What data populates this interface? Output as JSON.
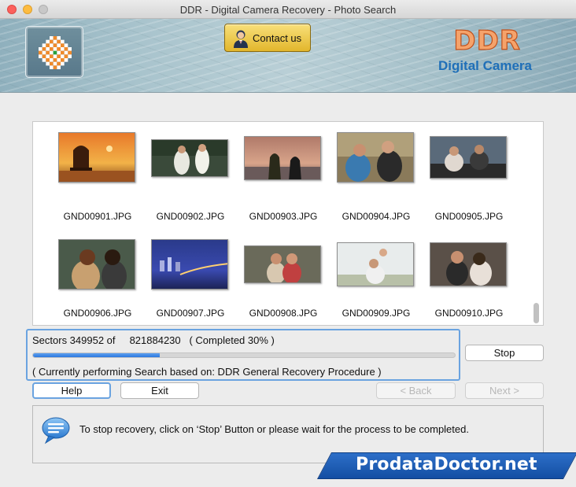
{
  "window": {
    "title": "DDR - Digital Camera Recovery - Photo Search"
  },
  "header": {
    "contact_label": "Contact us",
    "brand_name": "DDR",
    "brand_sub": "Digital Camera"
  },
  "gallery": {
    "files": [
      "GND00901.JPG",
      "GND00902.JPG",
      "GND00903.JPG",
      "GND00904.JPG",
      "GND00905.JPG",
      "GND00906.JPG",
      "GND00907.JPG",
      "GND00908.JPG",
      "GND00909.JPG",
      "GND00910.JPG"
    ]
  },
  "progress": {
    "sectors_text": "Sectors 349952 of     821884230   ( Completed 30% )",
    "fraction": 0.3,
    "status_text": "( Currently performing Search based on: DDR General Recovery Procedure )"
  },
  "buttons": {
    "stop": "Stop",
    "help": "Help",
    "exit": "Exit",
    "back": "< Back",
    "next": "Next >"
  },
  "info": {
    "message": "To stop recovery, click on ‘Stop’ Button or please wait for the process to be completed."
  },
  "watermark": "ProdataDoctor.net",
  "icons": {
    "app_logo": "checker-logo-icon",
    "contact": "person-icon",
    "info": "chat-bubble-icon"
  },
  "colors": {
    "focus_blue": "#6aa3e0",
    "progress_fill": "#2c78de",
    "brand_orange": "#f5a36b",
    "brand_blue": "#1f6fb8"
  }
}
